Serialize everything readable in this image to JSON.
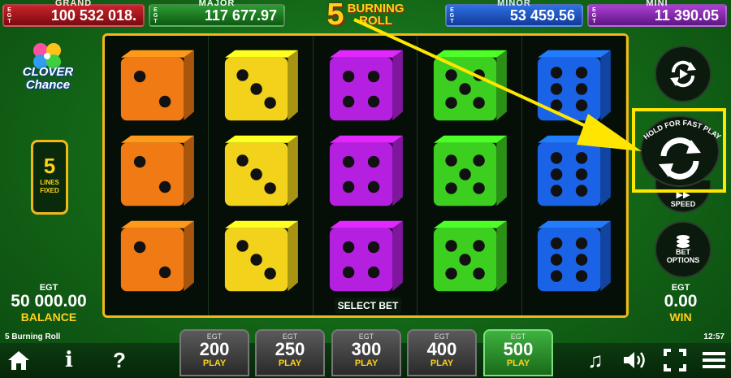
{
  "jackpots": {
    "grand": {
      "name": "GRAND",
      "egt": "EGT",
      "amount": "100   532 018."
    },
    "major": {
      "name": "MAJOR",
      "egt": "EGT",
      "amount": "117 677.97"
    },
    "minor": {
      "name": "MINOR",
      "egt": "EGT",
      "amount": "53 459.56"
    },
    "mini": {
      "name": "MINI",
      "egt": "EGT",
      "amount": "11 390.05"
    }
  },
  "title": {
    "number": "5",
    "line1": "BURNING",
    "line2": "ROLL"
  },
  "logo": {
    "line1": "CLOVER",
    "line2": "Chance"
  },
  "lines": {
    "number": "5",
    "label1": "LINES",
    "label2": "FIXED"
  },
  "reels": [
    {
      "color": "#f07a14",
      "faces": [
        2,
        2,
        2
      ]
    },
    {
      "color": "#f2d21a",
      "faces": [
        3,
        3,
        3
      ]
    },
    {
      "color": "#b51fe0",
      "faces": [
        4,
        4,
        4
      ]
    },
    {
      "color": "#3ccf1f",
      "faces": [
        5,
        5,
        5
      ]
    },
    {
      "color": "#1a63e6",
      "faces": [
        6,
        6,
        6
      ]
    }
  ],
  "select_bet_label": "SELECT BET",
  "controls": {
    "hold_text": "HOLD FOR FAST PLAY",
    "speed_label": "SPEED",
    "bet_options_line1": "BET",
    "bet_options_line2": "OPTIONS"
  },
  "balance": {
    "egt": "EGT",
    "value": "50 000.00",
    "label": "BALANCE"
  },
  "win": {
    "egt": "EGT",
    "value": "0.00",
    "label": "WIN"
  },
  "footer": {
    "game_name": "5 Burning Roll",
    "clock": "12:57"
  },
  "bets": [
    {
      "egt": "EGT",
      "amount": "200",
      "play": "PLAY",
      "active": false
    },
    {
      "egt": "EGT",
      "amount": "250",
      "play": "PLAY",
      "active": false
    },
    {
      "egt": "EGT",
      "amount": "300",
      "play": "PLAY",
      "active": false
    },
    {
      "egt": "EGT",
      "amount": "400",
      "play": "PLAY",
      "active": false
    },
    {
      "egt": "EGT",
      "amount": "500",
      "play": "PLAY",
      "active": true
    }
  ],
  "bottom_icons": {
    "home": "home-icon",
    "info": "i",
    "help": "?",
    "music": "music-icon",
    "sound": "speaker-icon",
    "fullscreen": "fullscreen-icon",
    "menu": "menu-icon"
  },
  "colors": {
    "gold": "#ffd21a",
    "frame": "#f2b81a",
    "highlight": "#ffe600"
  }
}
